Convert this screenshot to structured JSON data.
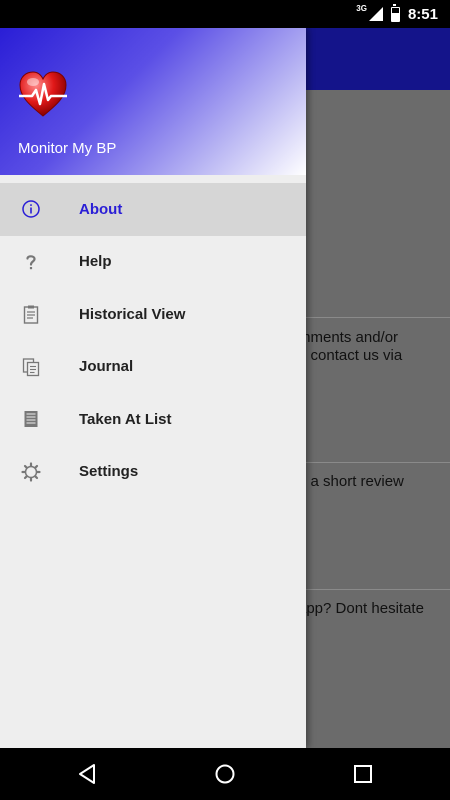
{
  "status_bar": {
    "network": "3G",
    "time": "8:51"
  },
  "background_app": {
    "snippets": [
      "mments and/or",
      "o contact us via",
      "n a short review",
      "app? Dont hesitate"
    ]
  },
  "drawer": {
    "app_name": "Monitor My BP",
    "logo_icon": "heart-pulse-icon",
    "accent_color": "#2a1ed6",
    "items": [
      {
        "label": "About",
        "icon": "info-icon",
        "active": true
      },
      {
        "label": "Help",
        "icon": "question-icon",
        "active": false
      },
      {
        "label": "Historical View",
        "icon": "clipboard-icon",
        "active": false
      },
      {
        "label": "Journal",
        "icon": "copy-icon",
        "active": false
      },
      {
        "label": "Taken At List",
        "icon": "list-icon",
        "active": false
      },
      {
        "label": "Settings",
        "icon": "gear-icon",
        "active": false
      }
    ]
  },
  "nav_bar": {
    "buttons": [
      "back",
      "home",
      "recents"
    ]
  }
}
